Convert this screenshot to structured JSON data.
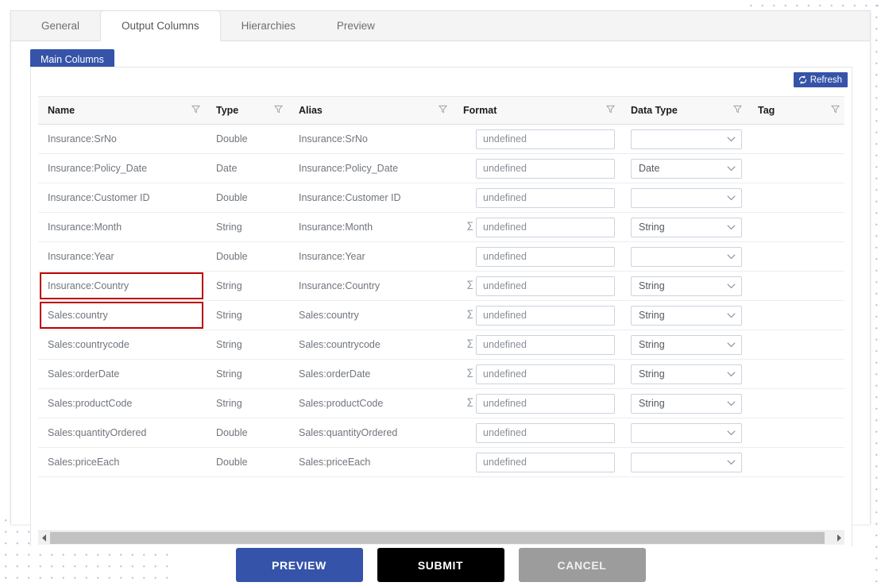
{
  "tabs": [
    {
      "label": "General",
      "active": false
    },
    {
      "label": "Output Columns",
      "active": true
    },
    {
      "label": "Hierarchies",
      "active": false
    },
    {
      "label": "Preview",
      "active": false
    }
  ],
  "subtab": {
    "label": "Main Columns"
  },
  "toolbar": {
    "refresh_label": "Refresh",
    "refresh_icon": "refresh-icon"
  },
  "table": {
    "headers": [
      "Name",
      "Type",
      "Alias",
      "Format",
      "Data Type",
      "Tag"
    ],
    "filter_icon": "filter-funnel-icon",
    "sigma_symbol": "Σ",
    "rows": [
      {
        "name": "Insurance:SrNo",
        "type": "Double",
        "alias": "Insurance:SrNo",
        "sigma": false,
        "format": "undefined",
        "data_type": "",
        "tag": "",
        "highlight": false
      },
      {
        "name": "Insurance:Policy_Date",
        "type": "Date",
        "alias": "Insurance:Policy_Date",
        "sigma": false,
        "format": "undefined",
        "data_type": "Date",
        "tag": "",
        "highlight": false
      },
      {
        "name": "Insurance:Customer ID",
        "type": "Double",
        "alias": "Insurance:Customer ID",
        "sigma": false,
        "format": "undefined",
        "data_type": "",
        "tag": "",
        "highlight": false
      },
      {
        "name": "Insurance:Month",
        "type": "String",
        "alias": "Insurance:Month",
        "sigma": true,
        "format": "undefined",
        "data_type": "String",
        "tag": "",
        "highlight": false
      },
      {
        "name": "Insurance:Year",
        "type": "Double",
        "alias": "Insurance:Year",
        "sigma": false,
        "format": "undefined",
        "data_type": "",
        "tag": "",
        "highlight": false
      },
      {
        "name": "Insurance:Country",
        "type": "String",
        "alias": "Insurance:Country",
        "sigma": true,
        "format": "undefined",
        "data_type": "String",
        "tag": "",
        "highlight": true
      },
      {
        "name": "Sales:country",
        "type": "String",
        "alias": "Sales:country",
        "sigma": true,
        "format": "undefined",
        "data_type": "String",
        "tag": "",
        "highlight": true
      },
      {
        "name": "Sales:countrycode",
        "type": "String",
        "alias": "Sales:countrycode",
        "sigma": true,
        "format": "undefined",
        "data_type": "String",
        "tag": "",
        "highlight": false
      },
      {
        "name": "Sales:orderDate",
        "type": "String",
        "alias": "Sales:orderDate",
        "sigma": true,
        "format": "undefined",
        "data_type": "String",
        "tag": "",
        "highlight": false
      },
      {
        "name": "Sales:productCode",
        "type": "String",
        "alias": "Sales:productCode",
        "sigma": true,
        "format": "undefined",
        "data_type": "String",
        "tag": "",
        "highlight": false
      },
      {
        "name": "Sales:quantityOrdered",
        "type": "Double",
        "alias": "Sales:quantityOrdered",
        "sigma": false,
        "format": "undefined",
        "data_type": "",
        "tag": "",
        "highlight": false
      },
      {
        "name": "Sales:priceEach",
        "type": "Double",
        "alias": "Sales:priceEach",
        "sigma": false,
        "format": "undefined",
        "data_type": "",
        "tag": "",
        "highlight": false
      }
    ]
  },
  "scrollbar": {
    "left_arrow_icon": "chevron-left-icon",
    "right_arrow_icon": "chevron-right-icon"
  },
  "footer": {
    "preview_label": "PREVIEW",
    "submit_label": "SUBMIT",
    "cancel_label": "CANCEL"
  },
  "colors": {
    "accent_blue": "#3553a8",
    "highlight_red": "#bb0000",
    "submit_black": "#000000",
    "cancel_gray": "#9c9c9c"
  }
}
